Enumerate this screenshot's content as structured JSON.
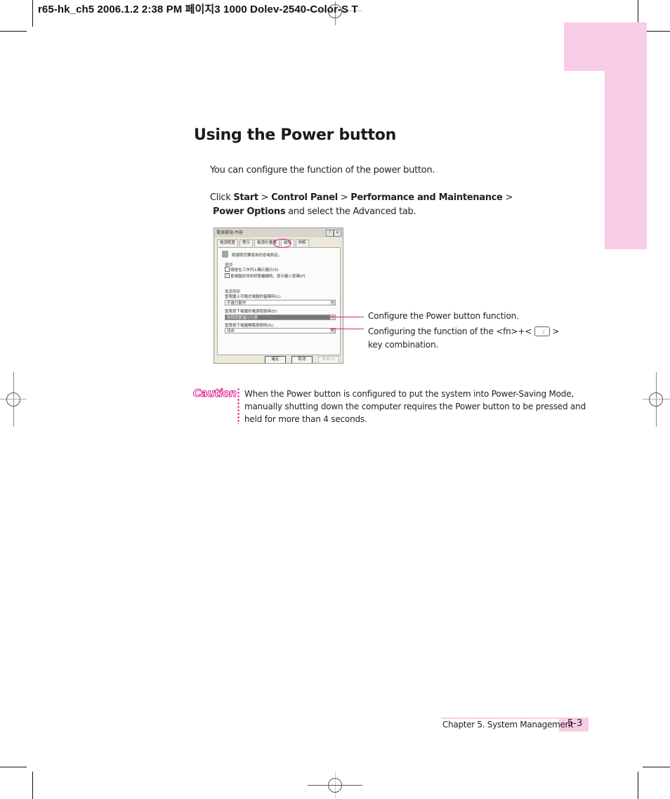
{
  "slug": "r65-hk_ch5  2006.1.2 2:38 PM  페이지3   1000 Dolev-2540-Color-S  T",
  "colors": {
    "accent_pink": "#e0218a",
    "tab_pink": "#f8cbe6",
    "text": "#231f20"
  },
  "heading": "Using the Power button",
  "intro": "You can configure the function of the power button.",
  "instruction": {
    "prefix": "Click ",
    "step1": "Start",
    "sep1": " > ",
    "step2": "Control Panel",
    "sep2": " > ",
    "step3": "Performance and Maintenance",
    "sep3": " >",
    "step4": "Power Options",
    "suffix": " and select the Advanced tab."
  },
  "dialog": {
    "title": "電源選項 內容",
    "help_button": "?",
    "close_button": "✕",
    "tabs": [
      {
        "label": "電源配置"
      },
      {
        "label": "警示"
      },
      {
        "label": "電源計量器"
      },
      {
        "label": "進階"
      },
      {
        "label": "休眠"
      }
    ],
    "description": "請選取您要使用的省電設定。",
    "options_group": "選項",
    "option1": "總是在工作列上顯示圖示(S)",
    "option1_checked": false,
    "option2": "當電腦從待命狀態繼續時，提示輸入密碼(P)",
    "option2_checked": true,
    "power_buttons_group": "電源按鈕",
    "lid_label": "當我闔上可攜式電腦的螢幕時(L):",
    "lid_value": "不進行動作",
    "power_label": "當我按下電腦的電源按鈕時(E):",
    "power_value": "詢問我要進行什麼",
    "sleep_label": "當我按下電腦睡眠按鈕時(S):",
    "sleep_value": "待命",
    "ok": "確定",
    "cancel": "取消",
    "apply": "套用(A)"
  },
  "callouts": {
    "first": "Configure the Power button function.",
    "second_prefix": "Configuring the function of the <fn>+<",
    "second_suffix": " >",
    "second_line2": "key combination.",
    "key_icon_label": "Fn-sleep-key"
  },
  "caution": {
    "label": "Caution",
    "lines": [
      "When the Power button is configured to put the system into Power-Saving Mode,",
      "manually shutting down the computer requires the Power button to be pressed and",
      "held for more than 4 seconds."
    ]
  },
  "footer": {
    "chapter": "Chapter 5. System Management",
    "page": "5-3"
  }
}
